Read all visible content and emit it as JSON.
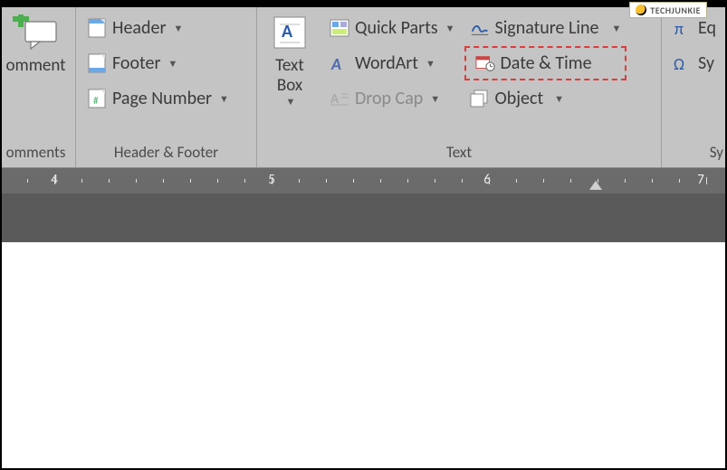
{
  "watermark": {
    "text": "TECHJUNKIE"
  },
  "ribbon": {
    "comments": {
      "comment_label": "omment",
      "group_label": "omments"
    },
    "header_footer": {
      "group_label": "Header & Footer",
      "header": "Header",
      "footer": "Footer",
      "page_number": "Page Number"
    },
    "text": {
      "group_label": "Text",
      "text_box": "Text\nBox",
      "quick_parts": "Quick Parts",
      "wordart": "WordArt",
      "drop_cap": "Drop Cap",
      "signature_line": "Signature Line",
      "date_time": "Date & Time",
      "object": "Object"
    },
    "symbols": {
      "group_label": "Sy",
      "equation": "Eq",
      "symbol": "Sy"
    }
  },
  "ruler": {
    "numbers": [
      "4",
      "5",
      "6",
      "7"
    ]
  }
}
